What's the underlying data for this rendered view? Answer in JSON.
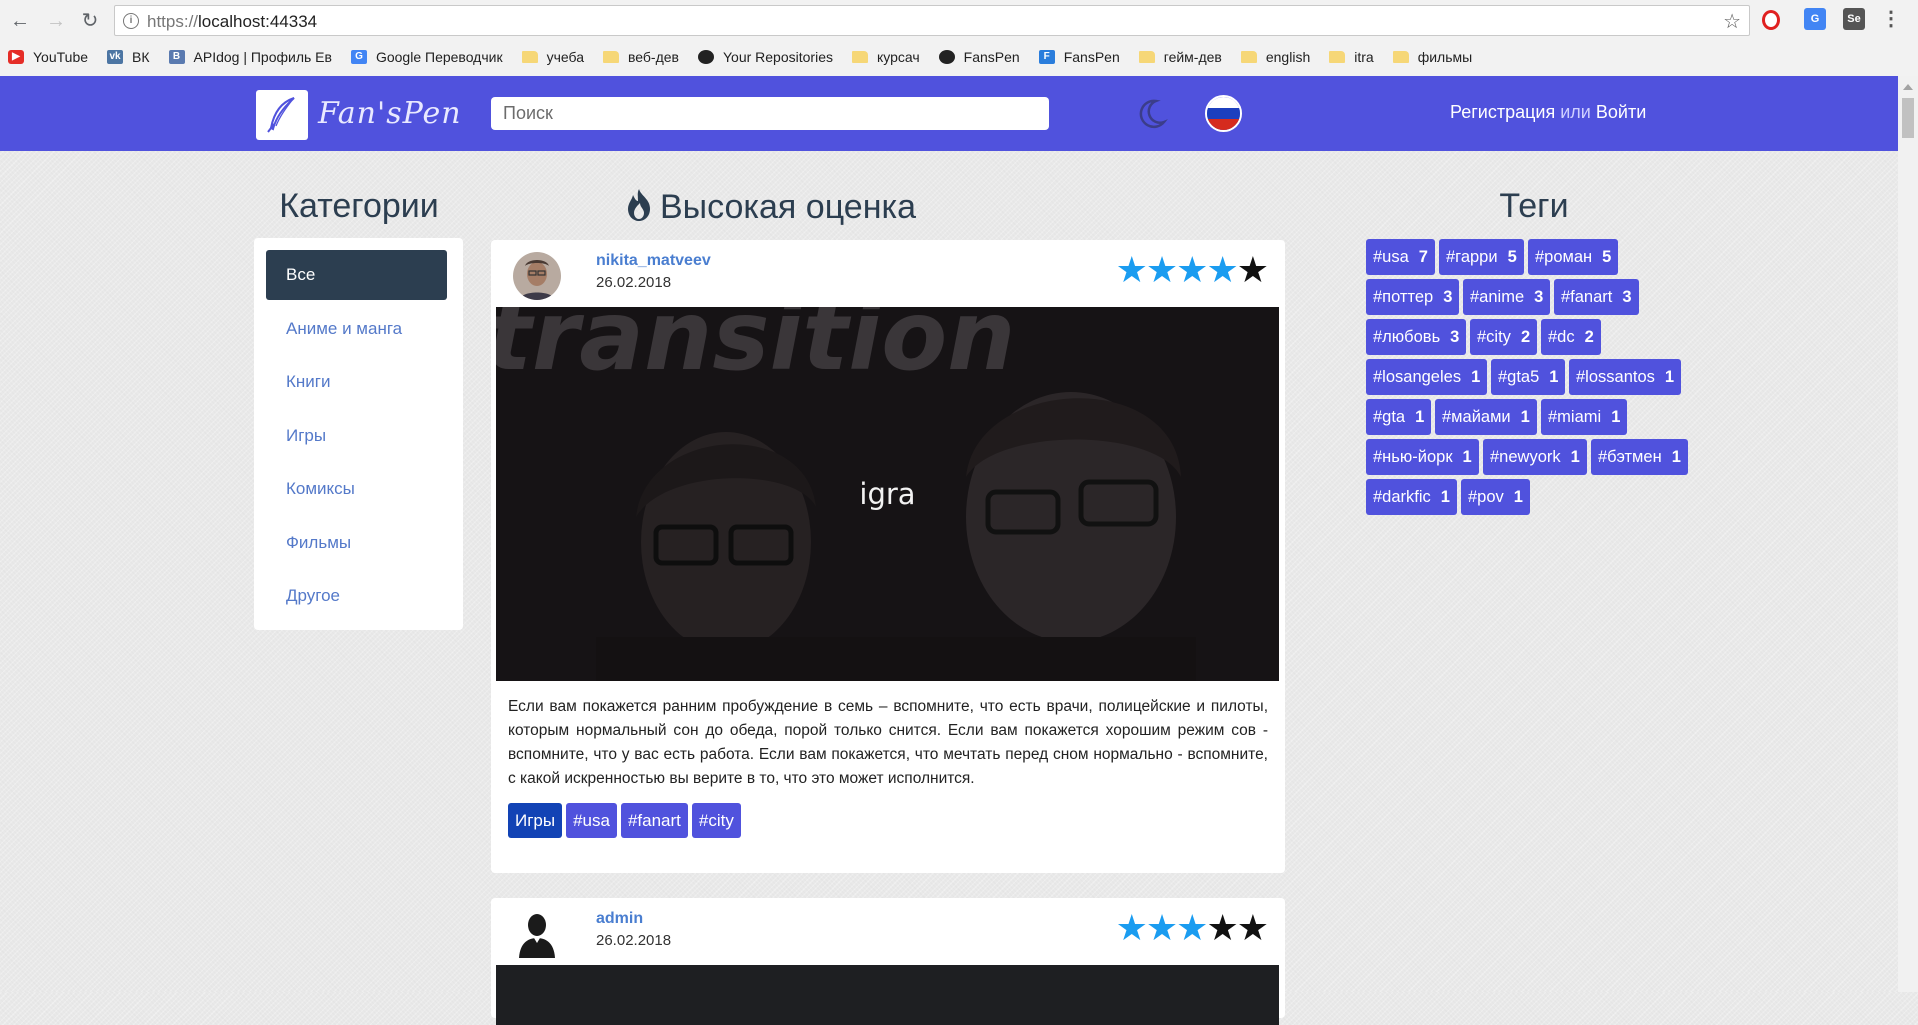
{
  "browser": {
    "url_prefix": "https://",
    "url_host": "localhost:44334",
    "bookmarks": [
      {
        "label": "YouTube",
        "icon": "youtube-icon"
      },
      {
        "label": "ВК",
        "icon": "vk-icon"
      },
      {
        "label": "APIdog | Профиль Ев",
        "icon": "apidog-icon"
      },
      {
        "label": "Google Переводчик",
        "icon": "google-translate-icon"
      },
      {
        "label": "учеба",
        "icon": "folder-icon"
      },
      {
        "label": "веб-дев",
        "icon": "folder-icon"
      },
      {
        "label": "Your Repositories",
        "icon": "github-icon"
      },
      {
        "label": "курсач",
        "icon": "folder-icon"
      },
      {
        "label": "FansPen",
        "icon": "github-icon"
      },
      {
        "label": "FansPen",
        "icon": "fanspen-icon"
      },
      {
        "label": "гейм-дев",
        "icon": "folder-icon"
      },
      {
        "label": "english",
        "icon": "folder-icon"
      },
      {
        "label": "itra",
        "icon": "folder-icon"
      },
      {
        "label": "фильмы",
        "icon": "folder-icon"
      }
    ]
  },
  "header": {
    "logo_text": "Fan'sPen",
    "search_placeholder": "Поиск",
    "register": "Регистрация",
    "or": "или",
    "login": "Войти",
    "accent": "#5052dd"
  },
  "categories": {
    "title": "Категории",
    "items": [
      "Все",
      "Аниме и манга",
      "Книги",
      "Игры",
      "Комиксы",
      "Фильмы",
      "Другое"
    ]
  },
  "feed": {
    "title": "Высокая оценка",
    "posts": [
      {
        "author": "nikita_matveev",
        "date": "26.02.2018",
        "rating": 4,
        "max_rating": 5,
        "image_title": "igra",
        "text": "Если вам покажется ранним пробуждение в семь – вспомните, что есть врачи, полицейские и пилоты, которым нормальный сон до обеда, порой только снится. Если вам покажется хорошим режим сов - вспомните, что у вас есть работа. Если вам покажется, что мечтать перед сном нормально - вспомните, с какой искренностью вы верите в то, что это может исполнится.",
        "category": "Игры",
        "tags": [
          "#usa",
          "#fanart",
          "#city"
        ]
      },
      {
        "author": "admin",
        "date": "26.02.2018",
        "rating": 3,
        "max_rating": 5
      }
    ]
  },
  "tags": {
    "title": "Теги",
    "items": [
      {
        "name": "#usa",
        "count": "7"
      },
      {
        "name": "#гарри",
        "count": "5"
      },
      {
        "name": "#роман",
        "count": "5"
      },
      {
        "name": "#поттер",
        "count": "3"
      },
      {
        "name": "#anime",
        "count": "3"
      },
      {
        "name": "#fanart",
        "count": "3"
      },
      {
        "name": "#любовь",
        "count": "3"
      },
      {
        "name": "#city",
        "count": "2"
      },
      {
        "name": "#dc",
        "count": "2"
      },
      {
        "name": "#losangeles",
        "count": "1"
      },
      {
        "name": "#gta5",
        "count": "1"
      },
      {
        "name": "#lossantos",
        "count": "1"
      },
      {
        "name": "#gta",
        "count": "1"
      },
      {
        "name": "#майами",
        "count": "1"
      },
      {
        "name": "#miami",
        "count": "1"
      },
      {
        "name": "#нью-йорк",
        "count": "1"
      },
      {
        "name": "#newyork",
        "count": "1"
      },
      {
        "name": "#бэтмен",
        "count": "1"
      },
      {
        "name": "#darkfic",
        "count": "1"
      },
      {
        "name": "#pov",
        "count": "1"
      }
    ]
  }
}
